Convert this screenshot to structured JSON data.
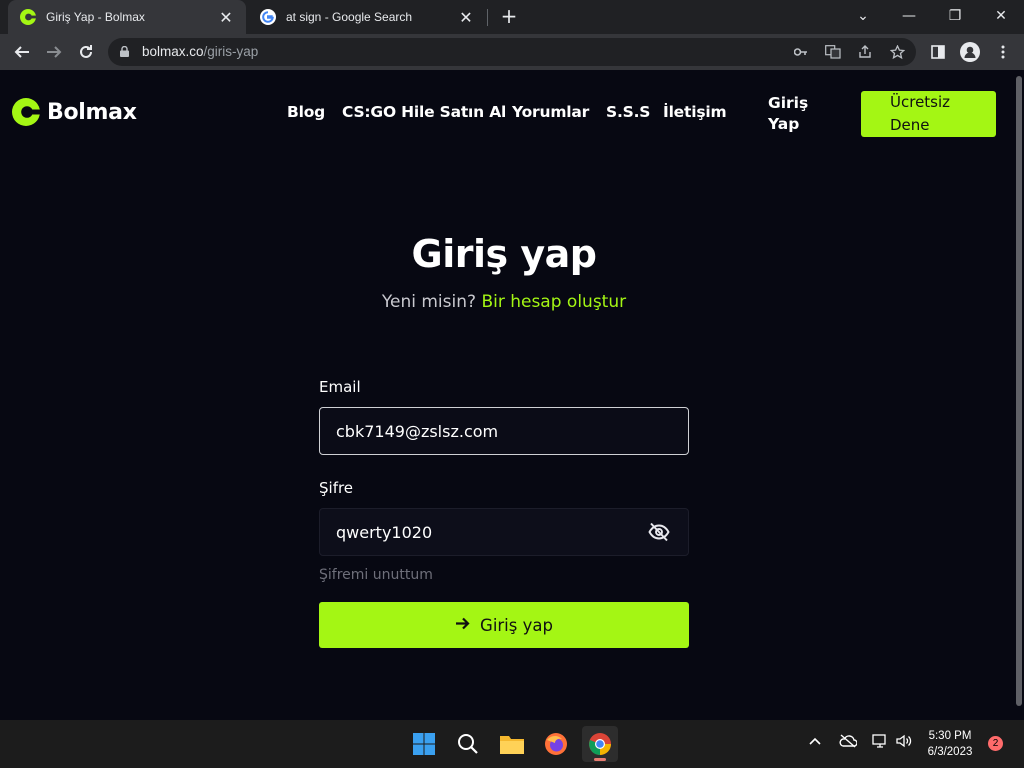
{
  "browser": {
    "tabs": [
      {
        "title": "Giriş Yap - Bolmax",
        "active": true,
        "favicon": "bolmax-favicon"
      },
      {
        "title": "at sign - Google Search",
        "active": false,
        "favicon": "google-favicon"
      }
    ],
    "new_tab_label": "+",
    "url_host": "bolmax.co",
    "url_path": "/giris-yap"
  },
  "site": {
    "brand": "Bolmax",
    "nav": [
      "Blog",
      "CS:GO Hile Satın Al",
      "Yorumlar",
      "S.S.S",
      "İletişim"
    ],
    "login_line1": "Giriş",
    "login_line2": "Yap",
    "cta_line1": "Ücretsiz",
    "cta_line2": "Dene",
    "accent_color": "#a4f614"
  },
  "login": {
    "title": "Giriş yap",
    "new_prompt": "Yeni misin?",
    "create_account": "Bir hesap oluştur",
    "email_label": "Email",
    "email_value": "cbk7149@zslsz.com",
    "password_label": "Şifre",
    "password_value": "qwerty1020",
    "forgot": "Şifremi unuttum",
    "submit": "Giriş yap"
  },
  "taskbar": {
    "time": "5:30 PM",
    "date": "6/3/2023",
    "notifications": "2"
  }
}
